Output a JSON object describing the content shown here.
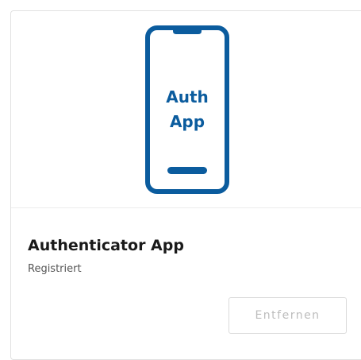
{
  "card": {
    "illustration": {
      "icon": "smartphone-icon",
      "label_line1": "Auth",
      "label_line2": "App",
      "color": "#0b5c9e"
    },
    "title": "Authenticator App",
    "status": "Registriert",
    "remove_label": "Entfernen"
  }
}
